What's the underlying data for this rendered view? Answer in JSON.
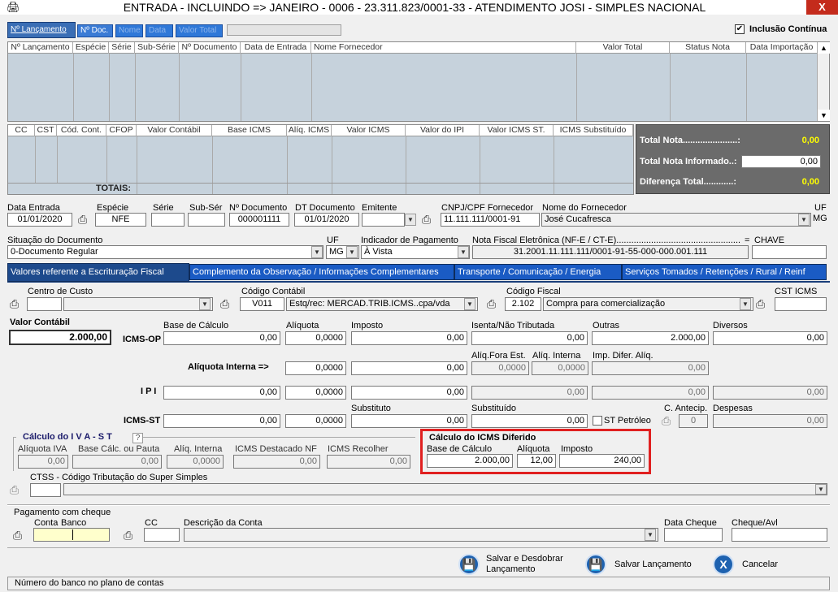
{
  "window": {
    "title": "ENTRADA  -  INCLUINDO   =>   JANEIRO  -  0006 - 23.311.823/0001-33 - ATENDIMENTO JOSI - SIMPLES NACIONAL",
    "close": "X"
  },
  "toolbar": {
    "tabs": [
      "Nº Lançamento",
      "Nº Doc.",
      "Nome",
      "Data",
      "Valor Total"
    ],
    "inclusao": "Inclusão Contínua"
  },
  "grid1": {
    "headers": [
      "Nº Lançamento",
      "Espécie",
      "Série",
      "Sub-Série",
      "Nº Documento",
      "Data de Entrada",
      "Nome Fornecedor",
      "Valor Total",
      "Status Nota",
      "Data Importação"
    ]
  },
  "grid2": {
    "headers": [
      "CC",
      "CST",
      "Cód. Cont.",
      "CFOP",
      "Valor Contábil",
      "Base ICMS",
      "Alíq. ICMS",
      "Valor ICMS",
      "Valor do IPI",
      "Valor ICMS ST.",
      "ICMS Substituído"
    ],
    "totals": "TOTAIS:"
  },
  "summary": {
    "total_nota_label": "Total Nota......................:",
    "total_nota": "0,00",
    "total_informado_label": "Total Nota Informado..:",
    "total_informado": "0,00",
    "diferenca_label": "Diferença Total............:",
    "diferenca": "0,00"
  },
  "doc": {
    "data_entrada_l": "Data Entrada",
    "data_entrada": "01/01/2020",
    "especie_l": "Espécie",
    "especie": "NFE",
    "serie_l": "Série",
    "serie": "",
    "subser_l": "Sub-Sér",
    "subser": "",
    "ndoc_l": "Nº Documento",
    "ndoc": "000001111",
    "dtdoc_l": "DT Documento",
    "dtdoc": "01/01/2020",
    "emitente_l": "Emitente",
    "emitente": "",
    "cnpj_l": "CNPJ/CPF Fornecedor",
    "cnpj": "11.111.111/0001-91",
    "nome_l": "Nome do Fornecedor",
    "nome": "José Cucafresca",
    "uf_l": "UF",
    "uf": "MG",
    "situacao_l": "Situação do Documento",
    "situacao": "0-Documento Regular",
    "uf2_l": "UF",
    "uf2": "MG",
    "pagamento_l": "Indicador de Pagamento",
    "pagamento": "À Vista",
    "nfe_l": "Nota Fiscal Eletrônica (NF-E / CT-E).......................................................",
    "eq": "=",
    "chave_l": "CHAVE",
    "nfe": "31.2001.11.111.111/0001-91-55-000-000.001.111",
    "chave": ""
  },
  "tabs2": [
    "Valores referente a Escrituração Fiscal",
    "Complemento da Observação / Informações Complementares",
    "Transporte / Comunicação / Energia",
    "Serviços Tomados / Retenções / Rural / Reinf"
  ],
  "fiscal": {
    "centro_custo_l": "Centro de Custo",
    "centro_custo": "",
    "centro_custo_desc": "",
    "codigo_contabil_l": "Código Contábil",
    "codigo_contabil": "V011",
    "codigo_contabil_desc": "Estq/rec: MERCAD.TRIB.ICMS..cpa/vda",
    "codigo_fiscal_l": "Código Fiscal",
    "codigo_fiscal": "2.102",
    "codigo_fiscal_desc": "Compra para comercialização",
    "cst_icms_l": "CST ICMS",
    "cst_icms": "",
    "valor_contabil_l": "Valor Contábil",
    "valor_contabil": "2.000,00",
    "base_calc_l": "Base de Cálculo",
    "aliquota_l": "Alíquota",
    "imposto_l": "Imposto",
    "isenta_l": "Isenta/Não Tributada",
    "outras_l": "Outras",
    "diversos_l": "Diversos",
    "icms_op_l": "ICMS-OP",
    "icms_op": {
      "base": "0,00",
      "aliq": "0,0000",
      "imposto": "0,00",
      "isenta": "0,00",
      "outras": "2.000,00",
      "diversos": "0,00"
    },
    "aliq_fora_l": "Alíq.Fora Est.",
    "aliq_interna_l": "Alíq. Interna",
    "imp_difer_l": "Imp. Difer. Alíq.",
    "aliq_interna_row_l": "Alíquota Interna =>",
    "aliq_interna_row": {
      "aliq": "0,0000",
      "valor": "0,00",
      "fora": "0,0000",
      "interna": "0,0000",
      "difer": "0,00"
    },
    "ipi_l": "I P I",
    "ipi": {
      "base": "0,00",
      "aliq": "0,0000",
      "imposto": "0,00",
      "isenta": "0,00",
      "outras": "0,00",
      "diversos": "0,00"
    },
    "substituto_l": "Substituto",
    "substituido_l": "Substituído",
    "c_antecip_l": "C. Antecip.",
    "despesas_l": "Despesas",
    "icms_st_l": "ICMS-ST",
    "icms_st": {
      "base": "0,00",
      "aliq": "0,0000",
      "substituto": "0,00",
      "substituido": "0,00",
      "antecip": "0",
      "despesas": "0,00"
    },
    "st_petroleo_l": "ST Petróleo"
  },
  "iva": {
    "title": "Cálculo  do  I V A - S T",
    "help": "?",
    "aliq_iva_l": "Alíquota IVA",
    "aliq_iva": "0,00",
    "base_pauta_l": "Base Cálc. ou Pauta",
    "base_pauta": "0,00",
    "aliq_int_l": "Alíq. Interna",
    "aliq_int": "0,0000",
    "icms_dest_l": "ICMS Destacado NF",
    "icms_dest": "0,00",
    "icms_rec_l": "ICMS Recolher",
    "icms_rec": "0,00"
  },
  "diferido": {
    "title": "Cálculo do ICMS Diferido",
    "base_l": "Base de Cálculo",
    "base": "2.000,00",
    "aliq_l": "Alíquota",
    "aliq": "12,00",
    "imposto_l": "Imposto",
    "imposto": "240,00",
    "color": "#e02020"
  },
  "ctss": {
    "label": "CTSS - Código Tributação do Super Simples",
    "value": ""
  },
  "cheque": {
    "title": "Pagamento com cheque",
    "conta_l": "Conta",
    "banco_l": "Banco",
    "cc_l": "CC",
    "desc_l": "Descrição da Conta",
    "data_l": "Data Cheque",
    "cheque_l": "Cheque/Avl"
  },
  "actions": {
    "salvar_desdobrar": "Salvar e Desdobrar Lançamento",
    "salvar": "Salvar Lançamento",
    "cancelar": "Cancelar"
  },
  "status": {
    "text": "Número do banco no plano de contas"
  }
}
